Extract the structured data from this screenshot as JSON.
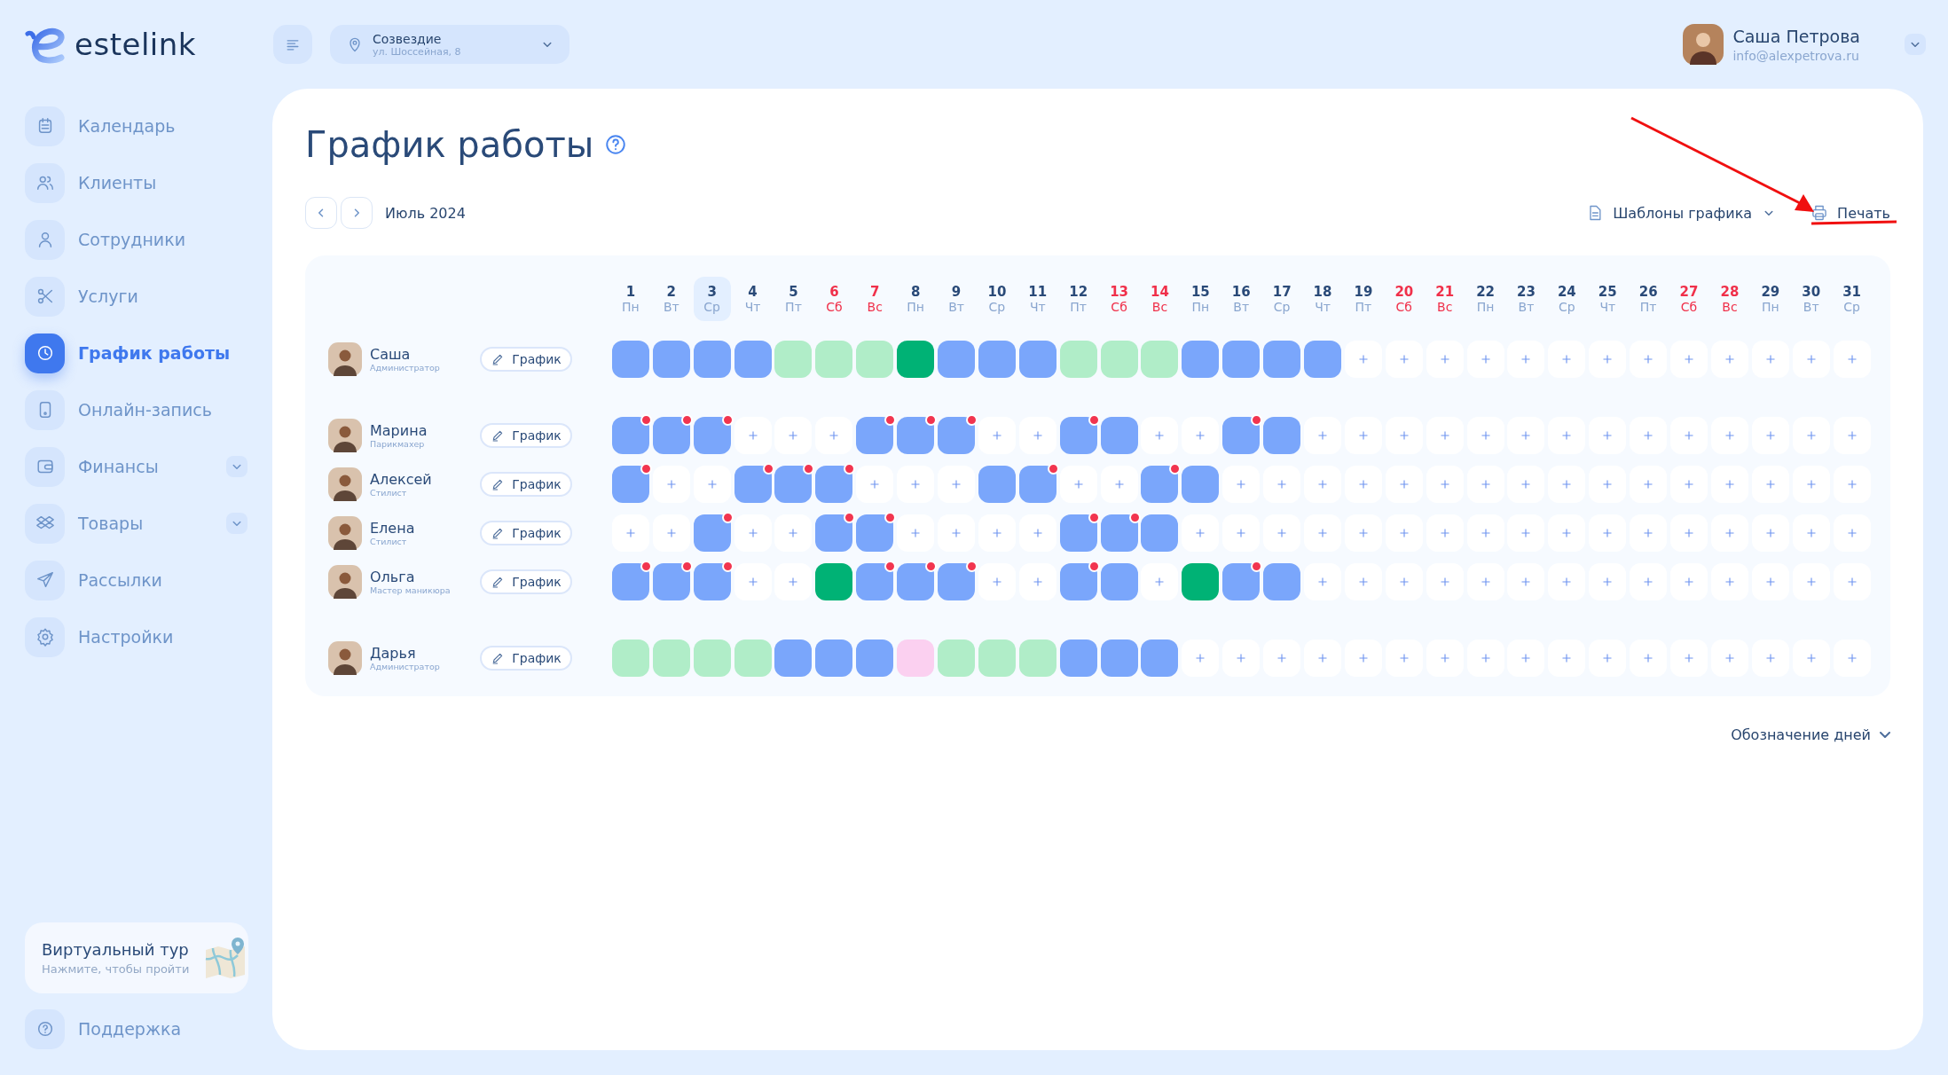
{
  "brand": {
    "name": "estelink"
  },
  "location": {
    "name": "Созвездие",
    "address": "ул. Шоссейная, 8"
  },
  "user": {
    "name": "Саша Петрова",
    "email": "info@alexpetrova.ru"
  },
  "sidebar": {
    "items": [
      {
        "label": "Календарь",
        "selected": false,
        "expandable": false
      },
      {
        "label": "Клиенты",
        "selected": false,
        "expandable": false
      },
      {
        "label": "Сотрудники",
        "selected": false,
        "expandable": false
      },
      {
        "label": "Услуги",
        "selected": false,
        "expandable": false
      },
      {
        "label": "График работы",
        "selected": true,
        "expandable": false
      },
      {
        "label": "Онлайн-запись",
        "selected": false,
        "expandable": false
      },
      {
        "label": "Финансы",
        "selected": false,
        "expandable": true
      },
      {
        "label": "Товары",
        "selected": false,
        "expandable": true
      },
      {
        "label": "Рассылки",
        "selected": false,
        "expandable": false
      },
      {
        "label": "Настройки",
        "selected": false,
        "expandable": false
      }
    ],
    "tour": {
      "title": "Виртуальный тур",
      "subtitle": "Нажмите, чтобы пройти"
    },
    "support": {
      "label": "Поддержка"
    }
  },
  "page": {
    "title": "График работы",
    "month": "Июль 2024",
    "templates": "Шаблоны графика",
    "print": "Печать",
    "legend": "Обозначение дней"
  },
  "days": [
    {
      "day": "1",
      "weekday": "Пн",
      "weekend": false,
      "selected": false
    },
    {
      "day": "2",
      "weekday": "Вт",
      "weekend": false,
      "selected": false
    },
    {
      "day": "3",
      "weekday": "Ср",
      "weekend": false,
      "selected": true
    },
    {
      "day": "4",
      "weekday": "Чт",
      "weekend": false,
      "selected": false
    },
    {
      "day": "5",
      "weekday": "Пт",
      "weekend": false,
      "selected": false
    },
    {
      "day": "6",
      "weekday": "Сб",
      "weekend": true,
      "selected": false
    },
    {
      "day": "7",
      "weekday": "Вс",
      "weekend": true,
      "selected": false
    },
    {
      "day": "8",
      "weekday": "Пн",
      "weekend": false,
      "selected": false
    },
    {
      "day": "9",
      "weekday": "Вт",
      "weekend": false,
      "selected": false
    },
    {
      "day": "10",
      "weekday": "Ср",
      "weekend": false,
      "selected": false
    },
    {
      "day": "11",
      "weekday": "Чт",
      "weekend": false,
      "selected": false
    },
    {
      "day": "12",
      "weekday": "Пт",
      "weekend": false,
      "selected": false
    },
    {
      "day": "13",
      "weekday": "Сб",
      "weekend": true,
      "selected": false
    },
    {
      "day": "14",
      "weekday": "Вс",
      "weekend": true,
      "selected": false
    },
    {
      "day": "15",
      "weekday": "Пн",
      "weekend": false,
      "selected": false
    },
    {
      "day": "16",
      "weekday": "Вт",
      "weekend": false,
      "selected": false
    },
    {
      "day": "17",
      "weekday": "Ср",
      "weekend": false,
      "selected": false
    },
    {
      "day": "18",
      "weekday": "Чт",
      "weekend": false,
      "selected": false
    },
    {
      "day": "19",
      "weekday": "Пт",
      "weekend": false,
      "selected": false
    },
    {
      "day": "20",
      "weekday": "Сб",
      "weekend": true,
      "selected": false
    },
    {
      "day": "21",
      "weekday": "Вс",
      "weekend": true,
      "selected": false
    },
    {
      "day": "22",
      "weekday": "Пн",
      "weekend": false,
      "selected": false
    },
    {
      "day": "23",
      "weekday": "Вт",
      "weekend": false,
      "selected": false
    },
    {
      "day": "24",
      "weekday": "Ср",
      "weekend": false,
      "selected": false
    },
    {
      "day": "25",
      "weekday": "Чт",
      "weekend": false,
      "selected": false
    },
    {
      "day": "26",
      "weekday": "Пт",
      "weekend": false,
      "selected": false
    },
    {
      "day": "27",
      "weekday": "Сб",
      "weekend": true,
      "selected": false
    },
    {
      "day": "28",
      "weekday": "Вс",
      "weekend": true,
      "selected": false
    },
    {
      "day": "29",
      "weekday": "Пн",
      "weekend": false,
      "selected": false
    },
    {
      "day": "30",
      "weekday": "Вт",
      "weekend": false,
      "selected": false
    },
    {
      "day": "31",
      "weekday": "Ср",
      "weekend": false,
      "selected": false
    }
  ],
  "groups": [
    {
      "employees": [
        {
          "name": "Саша",
          "role": "Администратор",
          "button": "График",
          "cells": [
            {
              "kind": "shift",
              "dot": false
            },
            {
              "kind": "shift",
              "dot": false
            },
            {
              "kind": "shift",
              "dot": false
            },
            {
              "kind": "shift",
              "dot": false
            },
            {
              "kind": "off",
              "dot": false
            },
            {
              "kind": "off",
              "dot": false
            },
            {
              "kind": "off",
              "dot": false
            },
            {
              "kind": "booked",
              "dot": false
            },
            {
              "kind": "shift",
              "dot": false
            },
            {
              "kind": "shift",
              "dot": false
            },
            {
              "kind": "shift",
              "dot": false
            },
            {
              "kind": "off",
              "dot": false
            },
            {
              "kind": "off",
              "dot": false
            },
            {
              "kind": "off",
              "dot": false
            },
            {
              "kind": "shift",
              "dot": false
            },
            {
              "kind": "shift",
              "dot": false
            },
            {
              "kind": "shift",
              "dot": false
            },
            {
              "kind": "shift",
              "dot": false
            },
            {
              "kind": "empty",
              "dot": false
            },
            {
              "kind": "empty",
              "dot": false
            },
            {
              "kind": "empty",
              "dot": false
            },
            {
              "kind": "empty",
              "dot": false
            },
            {
              "kind": "empty",
              "dot": false
            },
            {
              "kind": "empty",
              "dot": false
            },
            {
              "kind": "empty",
              "dot": false
            },
            {
              "kind": "empty",
              "dot": false
            },
            {
              "kind": "empty",
              "dot": false
            },
            {
              "kind": "empty",
              "dot": false
            },
            {
              "kind": "empty",
              "dot": false
            },
            {
              "kind": "empty",
              "dot": false
            },
            {
              "kind": "empty",
              "dot": false
            }
          ]
        }
      ]
    },
    {
      "employees": [
        {
          "name": "Марина",
          "role": "Парикмахер",
          "button": "График",
          "cells": [
            {
              "kind": "shift",
              "dot": true
            },
            {
              "kind": "shift",
              "dot": true
            },
            {
              "kind": "shift",
              "dot": true
            },
            {
              "kind": "empty",
              "dot": false
            },
            {
              "kind": "empty",
              "dot": false
            },
            {
              "kind": "empty",
              "dot": false
            },
            {
              "kind": "shift",
              "dot": true
            },
            {
              "kind": "shift",
              "dot": true
            },
            {
              "kind": "shift",
              "dot": true
            },
            {
              "kind": "empty",
              "dot": false
            },
            {
              "kind": "empty",
              "dot": false
            },
            {
              "kind": "shift",
              "dot": true
            },
            {
              "kind": "shift",
              "dot": false
            },
            {
              "kind": "empty",
              "dot": false
            },
            {
              "kind": "empty",
              "dot": false
            },
            {
              "kind": "shift",
              "dot": true
            },
            {
              "kind": "shift",
              "dot": false
            },
            {
              "kind": "empty",
              "dot": false
            },
            {
              "kind": "empty",
              "dot": false
            },
            {
              "kind": "empty",
              "dot": false
            },
            {
              "kind": "empty",
              "dot": false
            },
            {
              "kind": "empty",
              "dot": false
            },
            {
              "kind": "empty",
              "dot": false
            },
            {
              "kind": "empty",
              "dot": false
            },
            {
              "kind": "empty",
              "dot": false
            },
            {
              "kind": "empty",
              "dot": false
            },
            {
              "kind": "empty",
              "dot": false
            },
            {
              "kind": "empty",
              "dot": false
            },
            {
              "kind": "empty",
              "dot": false
            },
            {
              "kind": "empty",
              "dot": false
            },
            {
              "kind": "empty",
              "dot": false
            }
          ]
        },
        {
          "name": "Алексей",
          "role": "Стилист",
          "button": "График",
          "cells": [
            {
              "kind": "shift",
              "dot": true
            },
            {
              "kind": "empty",
              "dot": false
            },
            {
              "kind": "empty",
              "dot": false
            },
            {
              "kind": "shift",
              "dot": true
            },
            {
              "kind": "shift",
              "dot": true
            },
            {
              "kind": "shift",
              "dot": true
            },
            {
              "kind": "empty",
              "dot": false
            },
            {
              "kind": "empty",
              "dot": false
            },
            {
              "kind": "empty",
              "dot": false
            },
            {
              "kind": "shift",
              "dot": false
            },
            {
              "kind": "shift",
              "dot": true
            },
            {
              "kind": "empty",
              "dot": false
            },
            {
              "kind": "empty",
              "dot": false
            },
            {
              "kind": "shift",
              "dot": true
            },
            {
              "kind": "shift",
              "dot": false
            },
            {
              "kind": "empty",
              "dot": false
            },
            {
              "kind": "empty",
              "dot": false
            },
            {
              "kind": "empty",
              "dot": false
            },
            {
              "kind": "empty",
              "dot": false
            },
            {
              "kind": "empty",
              "dot": false
            },
            {
              "kind": "empty",
              "dot": false
            },
            {
              "kind": "empty",
              "dot": false
            },
            {
              "kind": "empty",
              "dot": false
            },
            {
              "kind": "empty",
              "dot": false
            },
            {
              "kind": "empty",
              "dot": false
            },
            {
              "kind": "empty",
              "dot": false
            },
            {
              "kind": "empty",
              "dot": false
            },
            {
              "kind": "empty",
              "dot": false
            },
            {
              "kind": "empty",
              "dot": false
            },
            {
              "kind": "empty",
              "dot": false
            },
            {
              "kind": "empty",
              "dot": false
            }
          ]
        },
        {
          "name": "Елена",
          "role": "Стилист",
          "button": "График",
          "cells": [
            {
              "kind": "empty",
              "dot": false
            },
            {
              "kind": "empty",
              "dot": false
            },
            {
              "kind": "shift",
              "dot": true
            },
            {
              "kind": "empty",
              "dot": false
            },
            {
              "kind": "empty",
              "dot": false
            },
            {
              "kind": "shift",
              "dot": true
            },
            {
              "kind": "shift",
              "dot": true
            },
            {
              "kind": "empty",
              "dot": false
            },
            {
              "kind": "empty",
              "dot": false
            },
            {
              "kind": "empty",
              "dot": false
            },
            {
              "kind": "empty",
              "dot": false
            },
            {
              "kind": "shift",
              "dot": true
            },
            {
              "kind": "shift",
              "dot": true
            },
            {
              "kind": "shift",
              "dot": false
            },
            {
              "kind": "empty",
              "dot": false
            },
            {
              "kind": "empty",
              "dot": false
            },
            {
              "kind": "empty",
              "dot": false
            },
            {
              "kind": "empty",
              "dot": false
            },
            {
              "kind": "empty",
              "dot": false
            },
            {
              "kind": "empty",
              "dot": false
            },
            {
              "kind": "empty",
              "dot": false
            },
            {
              "kind": "empty",
              "dot": false
            },
            {
              "kind": "empty",
              "dot": false
            },
            {
              "kind": "empty",
              "dot": false
            },
            {
              "kind": "empty",
              "dot": false
            },
            {
              "kind": "empty",
              "dot": false
            },
            {
              "kind": "empty",
              "dot": false
            },
            {
              "kind": "empty",
              "dot": false
            },
            {
              "kind": "empty",
              "dot": false
            },
            {
              "kind": "empty",
              "dot": false
            },
            {
              "kind": "empty",
              "dot": false
            }
          ]
        },
        {
          "name": "Ольга",
          "role": "Мастер маникюра",
          "button": "График",
          "cells": [
            {
              "kind": "shift",
              "dot": true
            },
            {
              "kind": "shift",
              "dot": true
            },
            {
              "kind": "shift",
              "dot": true
            },
            {
              "kind": "empty",
              "dot": false
            },
            {
              "kind": "empty",
              "dot": false
            },
            {
              "kind": "booked",
              "dot": false
            },
            {
              "kind": "shift",
              "dot": true
            },
            {
              "kind": "shift",
              "dot": true
            },
            {
              "kind": "shift",
              "dot": true
            },
            {
              "kind": "empty",
              "dot": false
            },
            {
              "kind": "empty",
              "dot": false
            },
            {
              "kind": "shift",
              "dot": true
            },
            {
              "kind": "shift",
              "dot": false
            },
            {
              "kind": "empty",
              "dot": false
            },
            {
              "kind": "booked",
              "dot": false
            },
            {
              "kind": "shift",
              "dot": true
            },
            {
              "kind": "shift",
              "dot": false
            },
            {
              "kind": "empty",
              "dot": false
            },
            {
              "kind": "empty",
              "dot": false
            },
            {
              "kind": "empty",
              "dot": false
            },
            {
              "kind": "empty",
              "dot": false
            },
            {
              "kind": "empty",
              "dot": false
            },
            {
              "kind": "empty",
              "dot": false
            },
            {
              "kind": "empty",
              "dot": false
            },
            {
              "kind": "empty",
              "dot": false
            },
            {
              "kind": "empty",
              "dot": false
            },
            {
              "kind": "empty",
              "dot": false
            },
            {
              "kind": "empty",
              "dot": false
            },
            {
              "kind": "empty",
              "dot": false
            },
            {
              "kind": "empty",
              "dot": false
            },
            {
              "kind": "empty",
              "dot": false
            }
          ]
        }
      ]
    },
    {
      "employees": [
        {
          "name": "Дарья",
          "role": "Администратор",
          "button": "График",
          "cells": [
            {
              "kind": "off",
              "dot": false
            },
            {
              "kind": "off",
              "dot": false
            },
            {
              "kind": "off",
              "dot": false
            },
            {
              "kind": "off",
              "dot": false
            },
            {
              "kind": "shift",
              "dot": false
            },
            {
              "kind": "shift",
              "dot": false
            },
            {
              "kind": "shift",
              "dot": false
            },
            {
              "kind": "leave",
              "dot": false
            },
            {
              "kind": "off",
              "dot": false
            },
            {
              "kind": "off",
              "dot": false
            },
            {
              "kind": "off",
              "dot": false
            },
            {
              "kind": "shift",
              "dot": false
            },
            {
              "kind": "shift",
              "dot": false
            },
            {
              "kind": "shift",
              "dot": false
            },
            {
              "kind": "empty",
              "dot": false
            },
            {
              "kind": "empty",
              "dot": false
            },
            {
              "kind": "empty",
              "dot": false
            },
            {
              "kind": "empty",
              "dot": false
            },
            {
              "kind": "empty",
              "dot": false
            },
            {
              "kind": "empty",
              "dot": false
            },
            {
              "kind": "empty",
              "dot": false
            },
            {
              "kind": "empty",
              "dot": false
            },
            {
              "kind": "empty",
              "dot": false
            },
            {
              "kind": "empty",
              "dot": false
            },
            {
              "kind": "empty",
              "dot": false
            },
            {
              "kind": "empty",
              "dot": false
            },
            {
              "kind": "empty",
              "dot": false
            },
            {
              "kind": "empty",
              "dot": false
            },
            {
              "kind": "empty",
              "dot": false
            },
            {
              "kind": "empty",
              "dot": false
            },
            {
              "kind": "empty",
              "dot": false
            }
          ]
        }
      ]
    }
  ]
}
